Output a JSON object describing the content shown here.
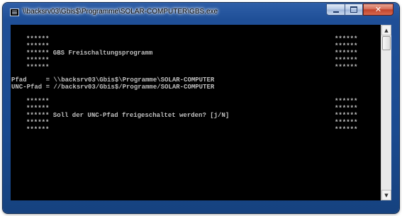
{
  "window": {
    "title": "\\\\backsrv03\\Gbis$\\Programme\\SOLAR-COMPUTER\\GBS.exe",
    "controls": {
      "minimize": "minimize",
      "maximize": "maximize",
      "close": "close"
    }
  },
  "console": {
    "lines": [
      {
        "left": "******",
        "text": "",
        "right": "******"
      },
      {
        "left": "******",
        "text": "",
        "right": "******"
      },
      {
        "left": "******",
        "text": " GBS Freischaltungsprogramm",
        "right": "******"
      },
      {
        "left": "******",
        "text": "",
        "right": "******"
      },
      {
        "left": "******",
        "text": "",
        "right": "******"
      },
      {
        "plain": "Pfad     = \\\\backsrv03\\Gbis$\\Programme\\SOLAR-COMPUTER"
      },
      {
        "plain": "UNC-Pfad = //backsrv03/Gbis$/Programme/SOLAR-COMPUTER"
      },
      {
        "left": "******",
        "text": "",
        "right": "******"
      },
      {
        "left": "******",
        "text": "",
        "right": "******"
      },
      {
        "left": "******",
        "text": " Soll der UNC-Pfad freigeschaltet werden? [j/N]",
        "right": "******"
      },
      {
        "left": "******",
        "text": "",
        "right": "******"
      },
      {
        "left": "******",
        "text": "",
        "right": "******"
      }
    ]
  },
  "scrollbar": {
    "up_arrow": "▲",
    "down_arrow": "▼"
  }
}
